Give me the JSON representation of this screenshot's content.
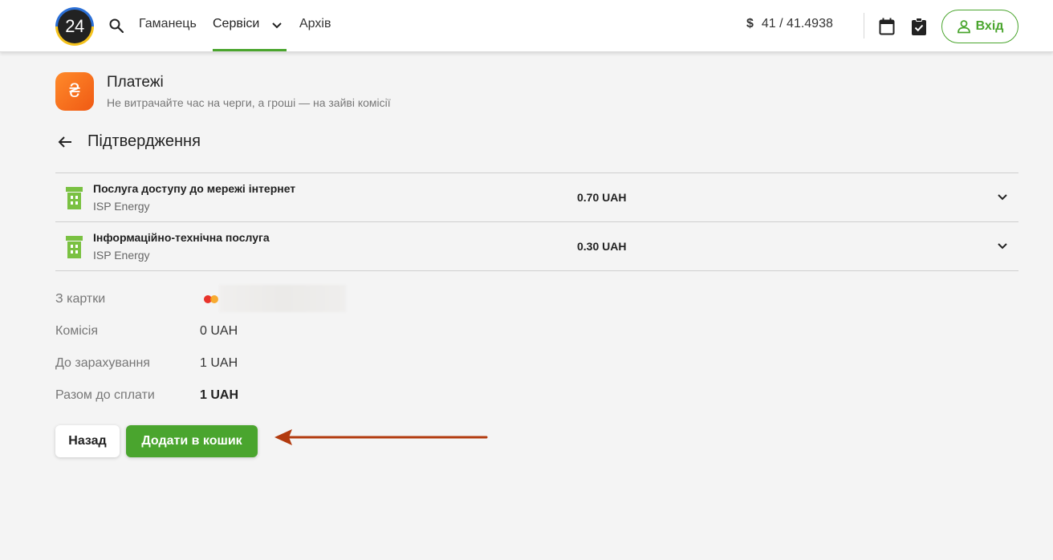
{
  "header": {
    "logo_text": "24",
    "nav": {
      "wallet": "Гаманець",
      "services": "Сервіси",
      "archive": "Архів"
    },
    "rate": {
      "currency_symbol": "$",
      "value": "41 / 41.4938"
    },
    "login_label": "Вхід"
  },
  "page": {
    "app_icon_glyph": "₴",
    "app_title": "Платежі",
    "app_subtitle": "Не витрачайте час на черги, а гроші — на зайві комісії",
    "title": "Підтвердження"
  },
  "services": [
    {
      "name": "Послуга доступу до мережі інтернет",
      "provider": "ISP Energy",
      "amount": "0.70 UAH",
      "icon": "building-icon"
    },
    {
      "name": "Інформаційно-технічна послуга",
      "provider": "ISP Energy",
      "amount": "0.30 UAH",
      "icon": "building-icon"
    }
  ],
  "details": {
    "from_card_label": "З картки",
    "commission_label": "Комісія",
    "commission_value": "0 UAH",
    "credited_label": "До зарахування",
    "credited_value": "1 UAH",
    "total_label": "Разом до сплати",
    "total_value": "1 UAH"
  },
  "buttons": {
    "back": "Назад",
    "add_to_cart": "Додати в кошик"
  },
  "colors": {
    "accent": "#4aa52e",
    "app_icon": "#f26a1b",
    "annotation_arrow": "#b23a0e"
  }
}
